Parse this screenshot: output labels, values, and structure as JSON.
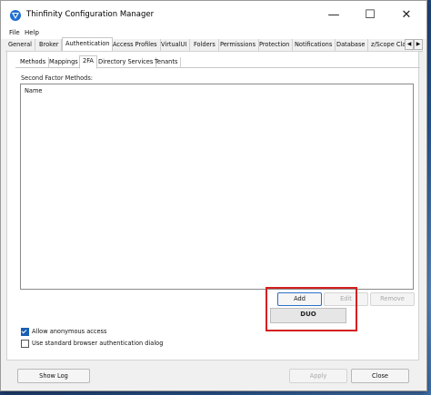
{
  "window": {
    "title": "Thinfinity Configuration Manager"
  },
  "menu": [
    "File",
    "Help"
  ],
  "tabs": [
    "General",
    "Broker",
    "Authentication",
    "Access Profiles",
    "VirtualUI",
    "Folders",
    "Permissions",
    "Protection",
    "Notifications",
    "Database",
    "z/Scope Clas"
  ],
  "active_tab": "Authentication",
  "subtabs": [
    "Methods",
    "Mappings",
    "2FA",
    "Directory Services",
    "Tenants"
  ],
  "active_subtab": "2FA",
  "second_factor": {
    "label": "Second Factor Methods:",
    "column_header": "Name",
    "buttons": {
      "add": "Add",
      "edit": "Edit",
      "remove": "Remove"
    },
    "dropdown_items": [
      "DUO"
    ]
  },
  "options": [
    {
      "label": "Allow anonymous access",
      "checked": true
    },
    {
      "label": "Use standard browser authentication dialog",
      "checked": false
    }
  ],
  "footer": {
    "show_log": "Show Log",
    "apply": "Apply",
    "close": "Close"
  },
  "icons": {
    "app": "thinfinity-logo-icon",
    "minimize": "minimize-icon",
    "maximize": "maximize-icon",
    "close": "close-icon"
  },
  "colors": {
    "accent": "#2a6fc9",
    "highlight": "#d42020"
  }
}
